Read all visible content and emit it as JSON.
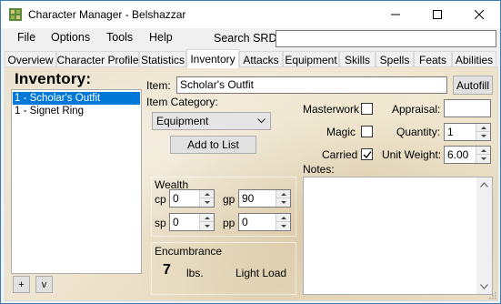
{
  "window": {
    "title": "Character Manager - Belshazzar"
  },
  "menu": {
    "file": "File",
    "options": "Options",
    "tools": "Tools",
    "help": "Help",
    "search_label": "Search SRD:",
    "search_value": ""
  },
  "tabs": [
    {
      "label": "Overview"
    },
    {
      "label": "Character Profile"
    },
    {
      "label": "Statistics"
    },
    {
      "label": "Inventory"
    },
    {
      "label": "Attacks"
    },
    {
      "label": "Equipment"
    },
    {
      "label": "Skills"
    },
    {
      "label": "Spells"
    },
    {
      "label": "Feats"
    },
    {
      "label": "Abilities"
    }
  ],
  "inventory": {
    "title": "Inventory:",
    "items": [
      "1 - Scholar's Outfit",
      "1 - Signet Ring"
    ],
    "add_button": "+",
    "move_down_button": "v"
  },
  "item_form": {
    "item_label": "Item:",
    "item_value": "Scholar's Outfit",
    "autofill_button": "Autofill",
    "category_label": "Item Category:",
    "category_value": "Equipment",
    "add_to_list_button": "Add to List",
    "masterwork_label": "Masterwork",
    "masterwork_checked": false,
    "magic_label": "Magic",
    "magic_checked": false,
    "carried_label": "Carried",
    "carried_checked": true,
    "appraisal_label": "Appraisal:",
    "appraisal_value": "",
    "quantity_label": "Quantity:",
    "quantity_value": "1",
    "unit_weight_label": "Unit Weight:",
    "unit_weight_value": "6.00",
    "notes_label": "Notes:",
    "notes_value": ""
  },
  "wealth": {
    "title": "Wealth",
    "cp_label": "cp",
    "cp_value": "0",
    "gp_label": "gp",
    "gp_value": "90",
    "sp_label": "sp",
    "sp_value": "0",
    "pp_label": "pp",
    "pp_value": "0"
  },
  "encumbrance": {
    "title": "Encumbrance",
    "weight": "7",
    "unit": "lbs.",
    "load": "Light Load"
  },
  "colors": {
    "selection": "#0078d7",
    "parchment": "#e9dfc7",
    "window_border": "#3b7fb4"
  }
}
